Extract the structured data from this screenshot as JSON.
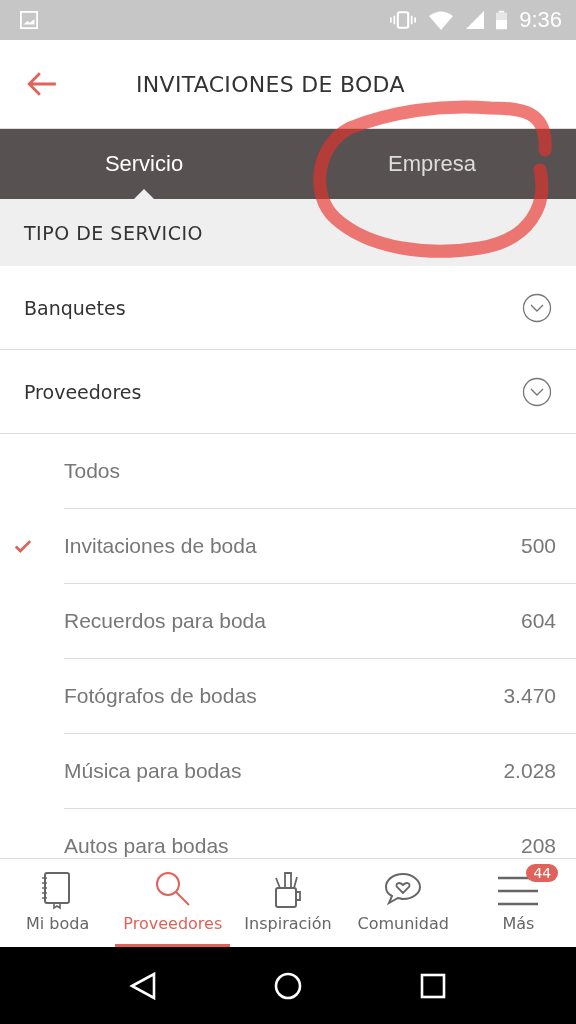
{
  "status_bar": {
    "time": "9:36"
  },
  "app_bar": {
    "title": "INVITACIONES DE BODA"
  },
  "tabs": [
    {
      "label": "Servicio",
      "selected": true
    },
    {
      "label": "Empresa",
      "selected": false
    }
  ],
  "annotation": {
    "kind": "circle"
  },
  "section": {
    "title": "TIPO DE SERVICIO"
  },
  "groups": [
    {
      "label": "Banquetes"
    },
    {
      "label": "Proveedores"
    }
  ],
  "items": [
    {
      "label": "Todos",
      "selected": false
    },
    {
      "label": "Invitaciones de boda",
      "count": "500",
      "selected": true
    },
    {
      "label": "Recuerdos para boda",
      "count": "604",
      "selected": false
    },
    {
      "label": "Fotógrafos de bodas",
      "count": "3.470",
      "selected": false
    },
    {
      "label": "Música para bodas",
      "count": "2.028",
      "selected": false
    },
    {
      "label": "Autos para bodas",
      "count": "208",
      "selected": false
    }
  ],
  "bottom_nav": [
    {
      "kind": "notebook",
      "label": "Mi boda",
      "selected": false
    },
    {
      "kind": "search",
      "label": "Proveedores",
      "selected": true
    },
    {
      "kind": "cup",
      "label": "Inspiración",
      "selected": false
    },
    {
      "kind": "chat",
      "label": "Comunidad",
      "selected": false
    },
    {
      "kind": "menu",
      "label": "Más",
      "selected": false,
      "badge": "44"
    }
  ]
}
